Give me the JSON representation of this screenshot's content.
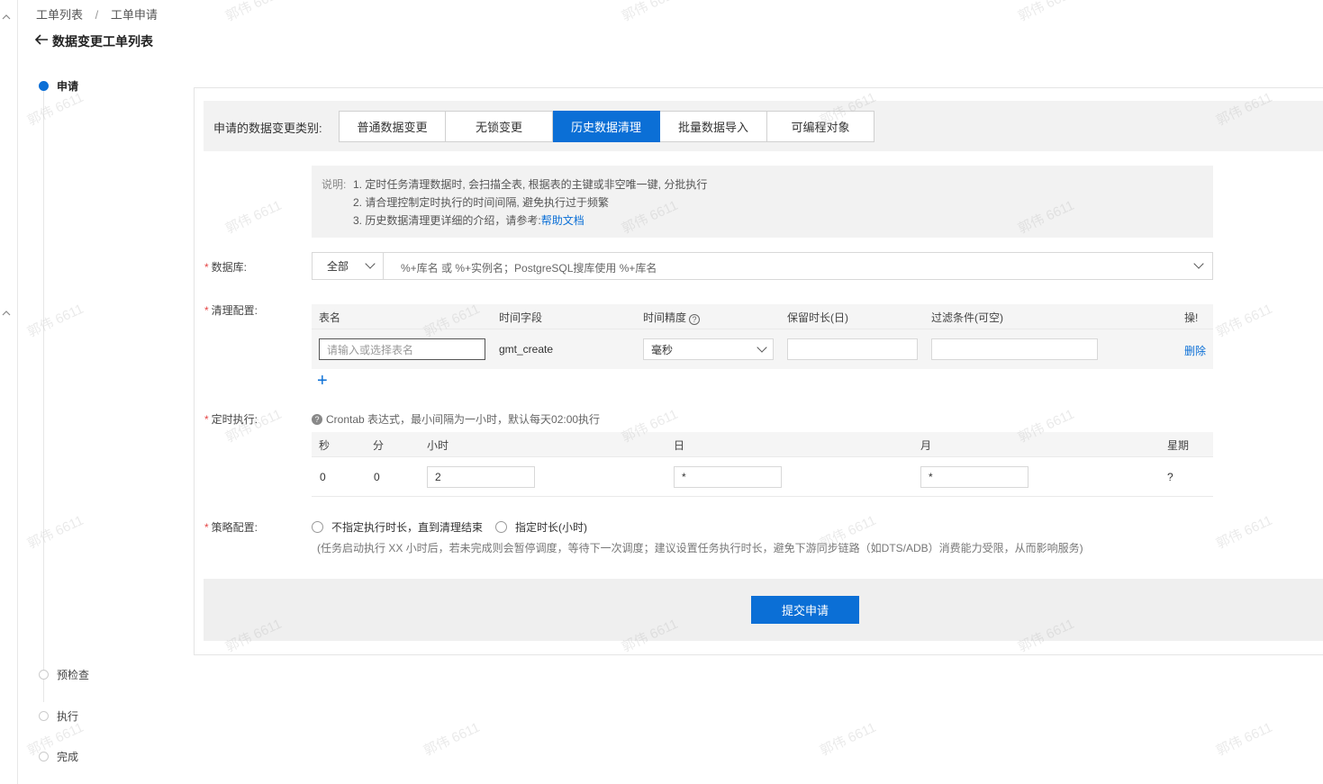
{
  "breadcrumb": {
    "items": [
      "工单列表",
      "工单申请"
    ],
    "separator": "/"
  },
  "header": {
    "back_title": "数据变更工单列表"
  },
  "steps": [
    {
      "label": "申请",
      "active": true
    },
    {
      "label": "预检查",
      "active": false
    },
    {
      "label": "执行",
      "active": false
    },
    {
      "label": "完成",
      "active": false
    }
  ],
  "change_type": {
    "label": "申请的数据变更类别:",
    "tabs": [
      "普通数据变更",
      "无锁变更",
      "历史数据清理",
      "批量数据导入",
      "可编程对象"
    ],
    "active_index": 2
  },
  "note": {
    "prefix": "说明:",
    "line1": "1. 定时任务清理数据时, 会扫描全表, 根据表的主键或非空唯一键, 分批执行",
    "line2": "2. 请合理控制定时执行的时间间隔, 避免执行过于频繁",
    "line3": "3. 历史数据清理更详细的介绍，请参考:",
    "link": "帮助文档"
  },
  "database": {
    "label": "数据库:",
    "scope": "全部",
    "placeholder": "%+库名 或 %+实例名；PostgreSQL搜库使用 %+库名"
  },
  "clean_config": {
    "label": "清理配置:",
    "columns": [
      "表名",
      "时间字段",
      "时间精度",
      "保留时长(日)",
      "过滤条件(可空)",
      "操作"
    ],
    "column_tail_visible": "操!",
    "row": {
      "table_placeholder": "请输入或选择表名",
      "time_field": "gmt_create",
      "precision": "毫秒",
      "retention": "",
      "filter": "",
      "action": "删除"
    },
    "add": "+"
  },
  "schedule": {
    "label": "定时执行:",
    "tip": "Crontab 表达式，最小间隔为一小时，默认每天02:00执行",
    "columns": [
      "秒",
      "分",
      "小时",
      "日",
      "月",
      "星期"
    ],
    "values": {
      "sec": "0",
      "min": "0",
      "hour": "2",
      "day": "*",
      "month": "*",
      "week": "?"
    }
  },
  "strategy": {
    "label": "策略配置:",
    "options": [
      "不指定执行时长，直到清理结束",
      "指定时长(小时)"
    ],
    "note": "(任务启动执行 XX 小时后，若未完成则会暂停调度，等待下一次调度；建议设置任务执行时长，避免下游同步链路（如DTS/ADB）消费能力受限，从而影响服务)"
  },
  "submit": {
    "label": "提交申请"
  },
  "watermark": "郭伟 6611",
  "colors": {
    "primary": "#0b6fd6",
    "required": "#e54545"
  },
  "icons": [
    "back-arrow-icon",
    "chevron-down-icon",
    "help-circle-icon",
    "plus-icon",
    "radio-icon"
  ]
}
